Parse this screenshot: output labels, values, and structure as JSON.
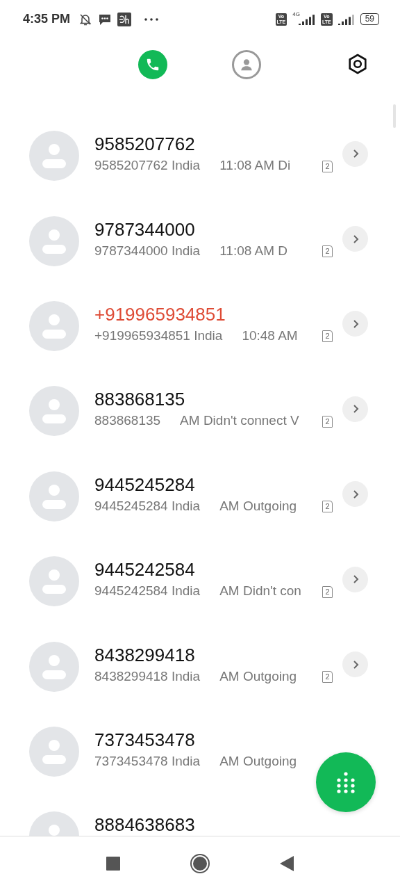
{
  "status_bar": {
    "time": "4:35 PM",
    "sims": [
      {
        "badge_top": "Vo",
        "badge_bottom": "LTE",
        "network": "4G"
      },
      {
        "badge_top": "Vo",
        "badge_bottom": "LTE"
      }
    ],
    "battery": "59"
  },
  "tabs": [
    {
      "kind": "calls",
      "selected": true
    },
    {
      "kind": "contacts",
      "selected": false
    }
  ],
  "calls": [
    {
      "name": "9585207762",
      "missed": false,
      "detail": "9585207762 India",
      "time": "11:08 AM Di",
      "sim": "2"
    },
    {
      "name": "9787344000",
      "missed": false,
      "detail": "9787344000 India",
      "time": "11:08 AM D",
      "sim": "2"
    },
    {
      "name": "+919965934851",
      "missed": true,
      "detail": "+919965934851 India",
      "time": "10:48 AM",
      "sim": "2"
    },
    {
      "name": "883868135",
      "missed": false,
      "detail": "883868135",
      "time": "AM Didn't connect V",
      "sim": "2"
    },
    {
      "name": "9445245284",
      "missed": false,
      "detail": "9445245284 India",
      "time": "AM Outgoing",
      "sim": "2"
    },
    {
      "name": "9445242584",
      "missed": false,
      "detail": "9445242584 India",
      "time": "AM Didn't con",
      "sim": "2"
    },
    {
      "name": "8438299418",
      "missed": false,
      "detail": "8438299418 India",
      "time": "AM Outgoing",
      "sim": "2"
    },
    {
      "name": "7373453478",
      "missed": false,
      "detail": "7373453478 India",
      "time": "AM Outgoing"
    },
    {
      "name": "8884638683",
      "missed": false
    }
  ]
}
